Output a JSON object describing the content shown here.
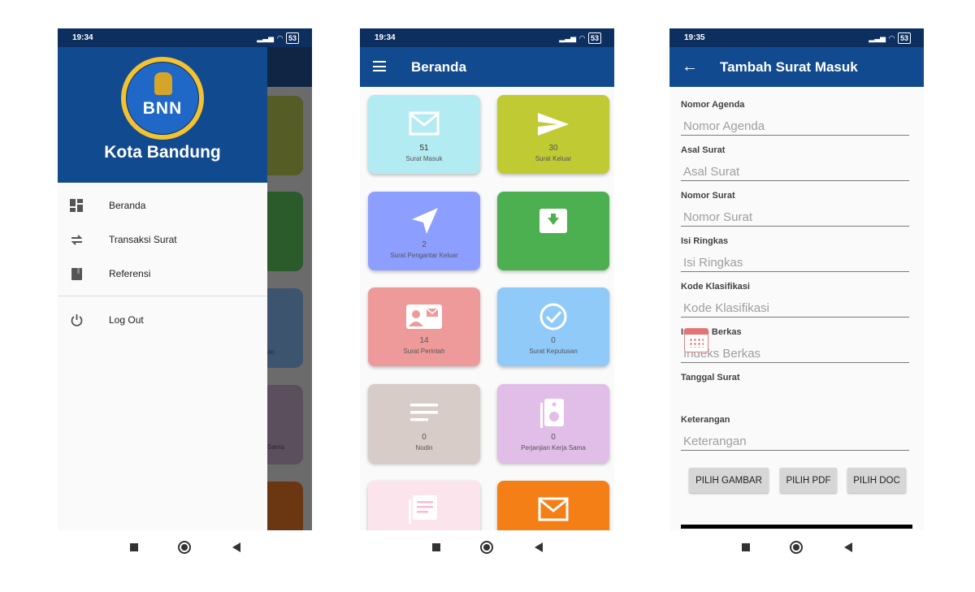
{
  "colors": {
    "primary_dark": "#0d2f5f",
    "primary": "#124a8f",
    "tile_surat_masuk": "#b3ebf2",
    "tile_surat_keluar": "#c0ca33",
    "tile_pengantar": "#8c9eff",
    "tile_arsip": "#4caf50",
    "tile_perintah": "#ef9a9a",
    "tile_keputusan": "#90caf9",
    "tile_nodin": "#d7ccc8",
    "tile_kerja_sama": "#e1bee7",
    "tile_pink": "#fce4ec",
    "tile_orange": "#f57f17"
  },
  "screen1": {
    "status_time": "19:34",
    "battery": "53",
    "drawer_title": "Kota Bandung",
    "logo_text": "BNN",
    "menu": [
      {
        "label": "Beranda",
        "icon": "dashboard-icon"
      },
      {
        "label": "Transaksi Surat",
        "icon": "swap-arrows-icon"
      },
      {
        "label": "Referensi",
        "icon": "book-icon"
      },
      {
        "label": "Log Out",
        "icon": "power-icon"
      }
    ],
    "behind_labels": [
      "an",
      "Sama"
    ]
  },
  "screen2": {
    "status_time": "19:34",
    "battery": "53",
    "title": "Beranda",
    "tiles": [
      {
        "count": "51",
        "label": "Surat Masuk",
        "icon": "mail-icon"
      },
      {
        "count": "30",
        "label": "Surat Keluar",
        "icon": "send-icon"
      },
      {
        "count": "2",
        "label": "Surat Pengantar Keluar",
        "icon": "navigation-icon"
      },
      {
        "count": "",
        "label": "",
        "icon": "archive-icon"
      },
      {
        "count": "14",
        "label": "Surat Perintah",
        "icon": "contact-card-icon"
      },
      {
        "count": "0",
        "label": "Surat Keputusan",
        "icon": "check-circle-icon"
      },
      {
        "count": "0",
        "label": "Nodin",
        "icon": "notes-icon"
      },
      {
        "count": "0",
        "label": "Perjanjian Kerja Sama",
        "icon": "speaker-icon"
      },
      {
        "count": "",
        "label": "",
        "icon": "library-books-icon"
      },
      {
        "count": "",
        "label": "",
        "icon": "mail-icon"
      }
    ]
  },
  "screen3": {
    "status_time": "19:35",
    "battery": "53",
    "title": "Tambah Surat Masuk",
    "fields": [
      {
        "label": "Nomor Agenda",
        "placeholder": "Nomor Agenda"
      },
      {
        "label": "Asal Surat",
        "placeholder": "Asal Surat"
      },
      {
        "label": "Nomor Surat",
        "placeholder": "Nomor Surat"
      },
      {
        "label": "Isi Ringkas",
        "placeholder": "Isi Ringkas"
      },
      {
        "label": "Kode Klasifikasi",
        "placeholder": "Kode Klasifikasi"
      },
      {
        "label": "Indeks Berkas",
        "placeholder": "Indeks Berkas"
      }
    ],
    "date_label": "Tanggal Surat",
    "keterangan_label": "Keterangan",
    "keterangan_placeholder": "Keterangan",
    "buttons": [
      "PILIH GAMBAR",
      "PILIH PDF",
      "PILIH DOC"
    ]
  }
}
